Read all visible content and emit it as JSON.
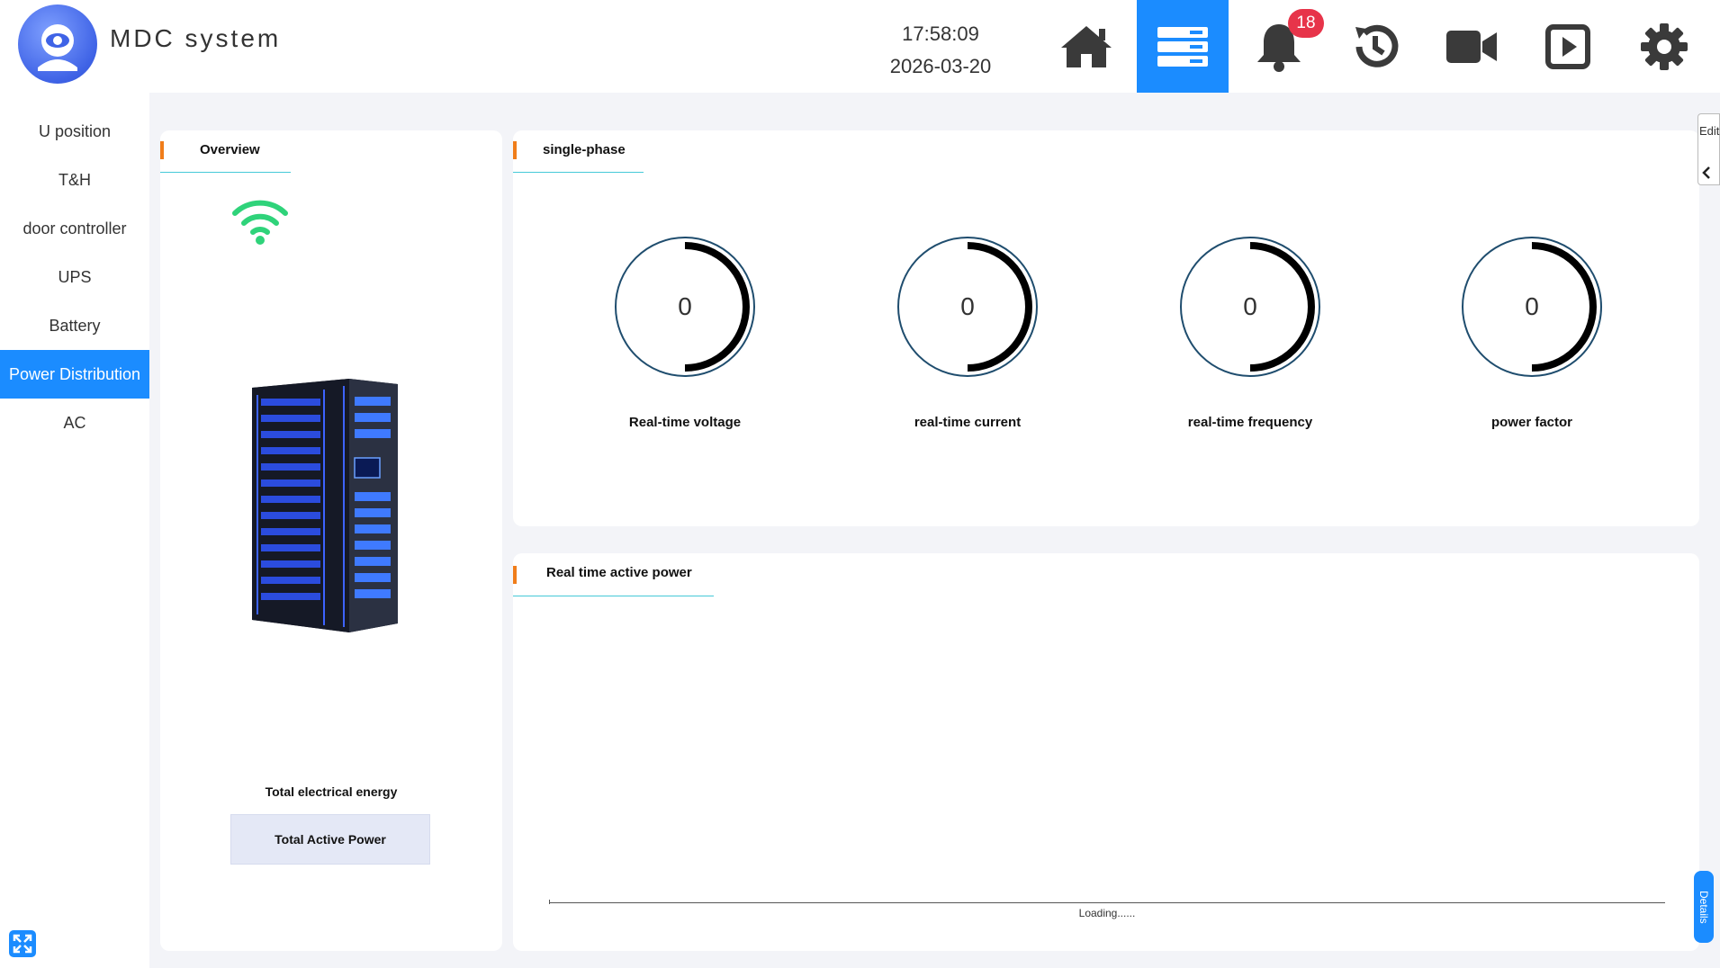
{
  "header": {
    "app_title": "MDC system",
    "time": "17:58:09",
    "date": "2026-03-20",
    "alarm_count": "18",
    "nav": [
      {
        "name": "home-icon"
      },
      {
        "name": "devices-icon",
        "active": true
      },
      {
        "name": "bell-icon"
      },
      {
        "name": "history-icon"
      },
      {
        "name": "video-camera-icon"
      },
      {
        "name": "playback-icon"
      },
      {
        "name": "gear-icon"
      }
    ]
  },
  "sidebar": {
    "items": [
      {
        "label": "U position"
      },
      {
        "label": "T&H"
      },
      {
        "label": "door controller"
      },
      {
        "label": "UPS"
      },
      {
        "label": "Battery"
      },
      {
        "label": "Power Distribution",
        "active": true
      },
      {
        "label": "AC"
      }
    ]
  },
  "overview": {
    "title": "Overview",
    "total_energy_label": "Total electrical energy",
    "total_power_label": "Total Active Power"
  },
  "single_phase": {
    "title": "single-phase",
    "gauges": [
      {
        "label": "Real-time voltage",
        "value": "0"
      },
      {
        "label": "real-time current",
        "value": "0"
      },
      {
        "label": "real-time frequency",
        "value": "0"
      },
      {
        "label": "power factor",
        "value": "0"
      }
    ]
  },
  "active_power": {
    "title": "Real time active power",
    "loading_text": "Loading......"
  },
  "edit_label": "Edit",
  "details_label": "Details",
  "colors": {
    "accent": "#1b8cff",
    "marker": "#f07d1a",
    "badge": "#e7344a",
    "wifi": "#2fd37a"
  }
}
